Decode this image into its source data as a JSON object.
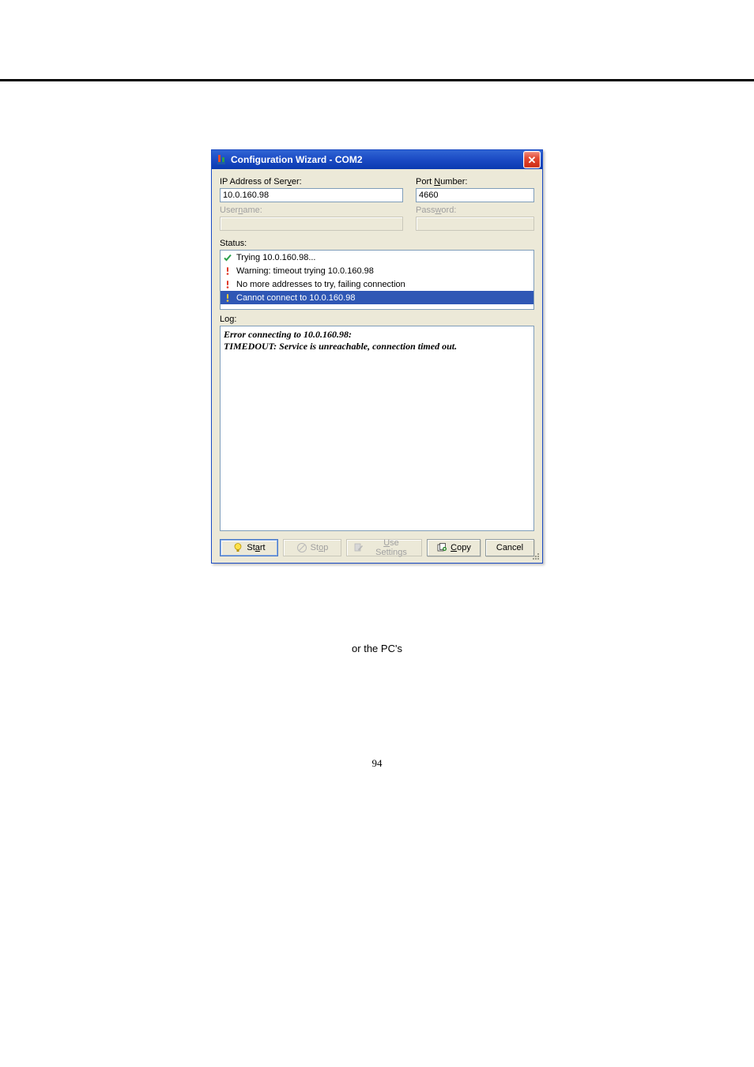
{
  "titlebar": {
    "title": "Configuration Wizard - COM2"
  },
  "labels": {
    "ip": "IP Address of Ser",
    "ip_ul": "v",
    "ip2": "er:",
    "port": "Port ",
    "port_ul": "N",
    "port2": "umber:",
    "user": "User",
    "user_ul": "n",
    "user2": "ame:",
    "pass": "Pass",
    "pass_ul": "w",
    "pass2": "ord:",
    "status": "Status:",
    "log": "Log:"
  },
  "fields": {
    "ip_value": "10.0.160.98",
    "port_value": "4660",
    "user_value": "",
    "pass_value": ""
  },
  "status_items": [
    {
      "icon": "check",
      "text": "Trying 10.0.160.98...",
      "selected": false
    },
    {
      "icon": "warn",
      "text": "Warning: timeout trying 10.0.160.98",
      "selected": false
    },
    {
      "icon": "warn",
      "text": "No more addresses to try, failing connection",
      "selected": false
    },
    {
      "icon": "warn",
      "text": "Cannot connect to 10.0.160.98",
      "selected": true
    }
  ],
  "log_lines": [
    "Error connecting to 10.0.160.98:",
    "TIMEDOUT: Service is unreachable, connection timed out."
  ],
  "buttons": {
    "start_pre": "St",
    "start_ul": "a",
    "start_post": "rt",
    "stop_pre": "St",
    "stop_ul": "o",
    "stop_post": "p",
    "use_ul": "U",
    "use_post": "se Settings",
    "copy_ul": "C",
    "copy_post": "opy",
    "cancel": "Cancel"
  },
  "caption": "or the PC's",
  "pagenum": "94"
}
